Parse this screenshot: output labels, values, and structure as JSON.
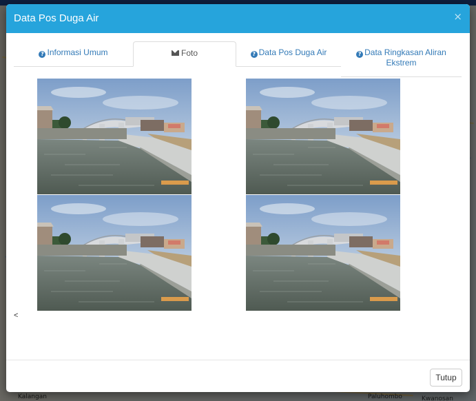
{
  "modal": {
    "title": "Data Pos Duga Air",
    "close_glyph": "×",
    "footer_button": "Tutup"
  },
  "tabs": [
    {
      "label": "Informasi Umum",
      "icon": "question-circle-icon",
      "active": false
    },
    {
      "label": "Foto",
      "icon": "envelope-icon",
      "active": true
    },
    {
      "label": "Data Pos Duga Air",
      "icon": "question-circle-icon",
      "active": false
    },
    {
      "label": "Data Ringkasan Aliran Ekstrem",
      "icon": "question-circle-icon",
      "active": false
    }
  ],
  "photos": [
    {
      "alt": "photo-river-bridge"
    },
    {
      "alt": "photo-river-bridge"
    },
    {
      "alt": "photo-river-bridge"
    },
    {
      "alt": "photo-river-bridge"
    }
  ],
  "photo_text": "",
  "stray_text": "<",
  "map_labels": [
    "Kalangan",
    "Paluhombo",
    "Kwanosan"
  ],
  "colors": {
    "header": "#26a4dc",
    "link": "#337ab7"
  }
}
